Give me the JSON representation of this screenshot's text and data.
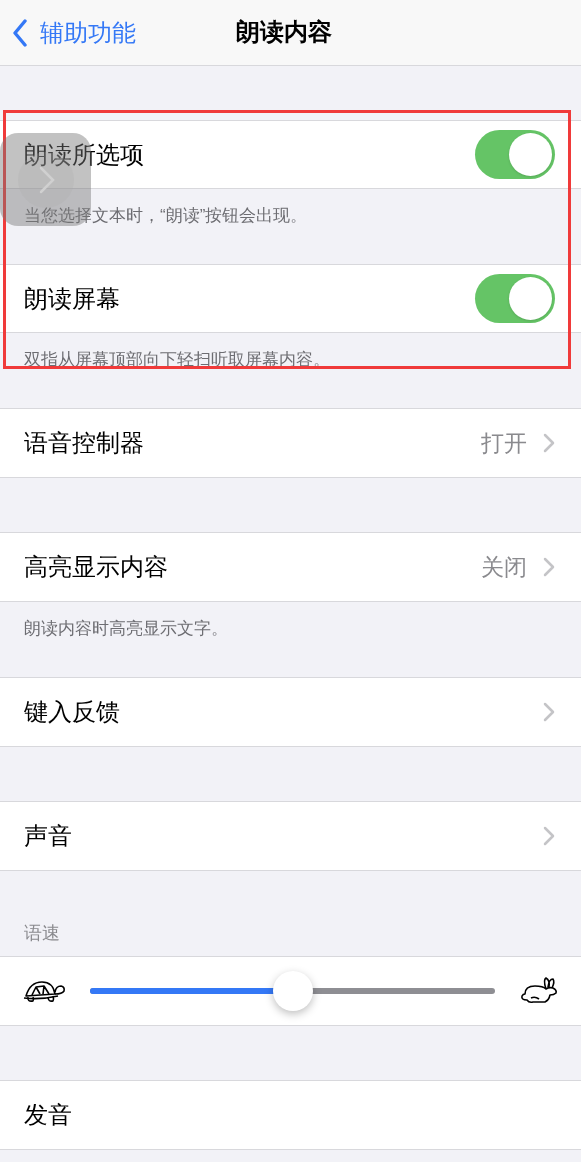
{
  "nav": {
    "back": "辅助功能",
    "title": "朗读内容"
  },
  "sections": [
    {
      "rows": [
        {
          "kind": "toggle",
          "label": "朗读所选项",
          "on": true
        }
      ],
      "footer": "当您选择文本时，“朗读”按钮会出现。"
    },
    {
      "rows": [
        {
          "kind": "toggle",
          "label": "朗读屏幕",
          "on": true
        }
      ],
      "footer": "双指从屏幕顶部向下轻扫听取屏幕内容。"
    },
    {
      "rows": [
        {
          "kind": "link",
          "label": "语音控制器",
          "value": "打开",
          "chevron": true
        }
      ]
    },
    {
      "rows": [
        {
          "kind": "link",
          "label": "高亮显示内容",
          "value": "关闭",
          "chevron": true
        }
      ],
      "footer": "朗读内容时高亮显示文字。"
    },
    {
      "rows": [
        {
          "kind": "link",
          "label": "键入反馈",
          "chevron": true
        }
      ]
    },
    {
      "rows": [
        {
          "kind": "link",
          "label": "声音",
          "chevron": true
        }
      ]
    },
    {
      "header": "语速",
      "rows": [
        {
          "kind": "slider",
          "level": 0.5
        }
      ]
    },
    {
      "rows": [
        {
          "kind": "link",
          "label": "发音",
          "chevron": false
        }
      ]
    }
  ]
}
